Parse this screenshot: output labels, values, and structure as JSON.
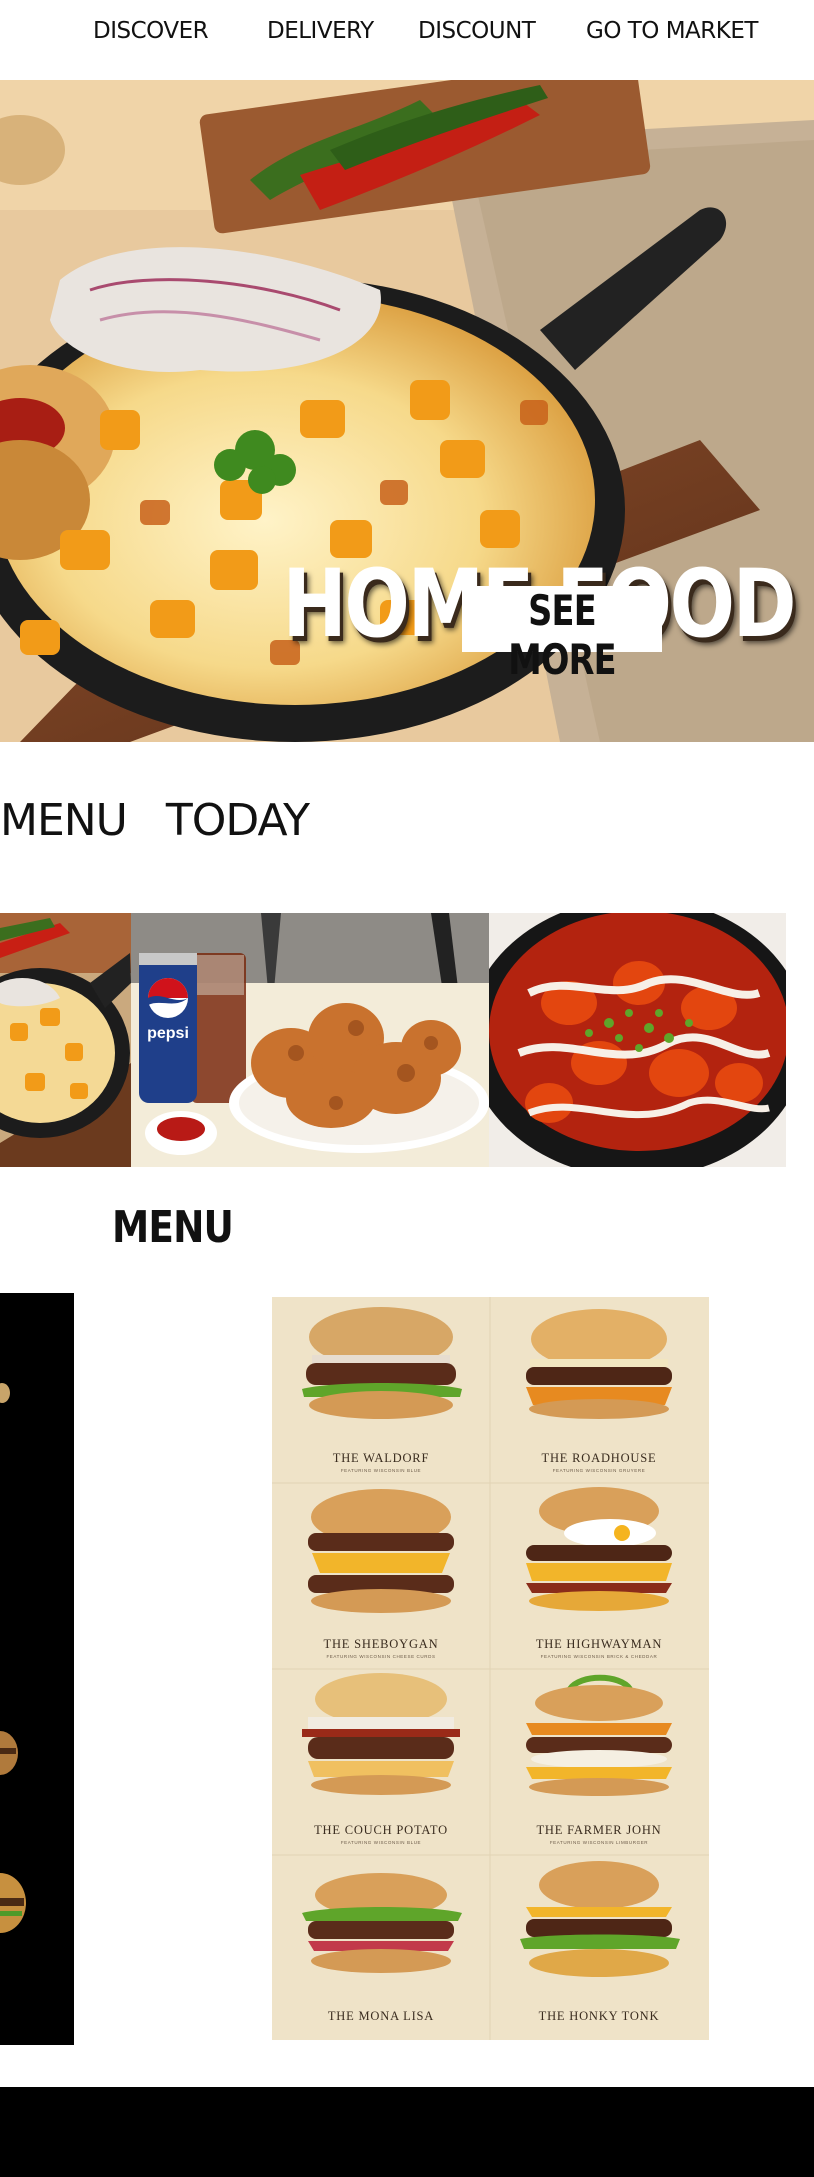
{
  "nav": {
    "items": [
      {
        "label": "DISCOVER"
      },
      {
        "label": "DELIVERY"
      },
      {
        "label": "DISCOUNT"
      },
      {
        "label": "GO TO MARKET"
      }
    ]
  },
  "hero": {
    "title": "HOME FOOD",
    "button_label": "SEE MORE"
  },
  "menu_today": {
    "heading": "MENU   TODAY",
    "can_text": "pepsi"
  },
  "menu": {
    "heading": "MENU",
    "burgers": [
      {
        "name": "THE WALDORF",
        "sub": "FEATURING WISCONSIN BLUE"
      },
      {
        "name": "THE ROADHOUSE",
        "sub": "FEATURING WISCONSIN GRUYERE"
      },
      {
        "name": "THE SHEBOYGAN",
        "sub": "FEATURING WISCONSIN CHEESE CURDS"
      },
      {
        "name": "THE HIGHWAYMAN",
        "sub": "FEATURING WISCONSIN BRICK & CHEDDAR"
      },
      {
        "name": "THE COUCH POTATO",
        "sub": "FEATURING WISCONSIN BLUE"
      },
      {
        "name": "THE FARMER JOHN",
        "sub": "FEATURING WISCONSIN LIMBURGER"
      },
      {
        "name": "THE MONA LISA",
        "sub": ""
      },
      {
        "name": "THE HONKY TONK",
        "sub": ""
      }
    ]
  }
}
